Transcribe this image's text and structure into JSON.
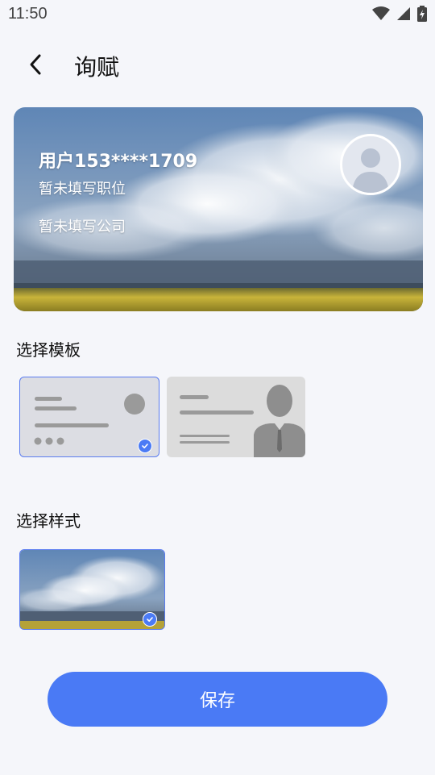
{
  "status_bar": {
    "time": "11:50"
  },
  "header": {
    "title": "询赋"
  },
  "card": {
    "name": "用户153****1709",
    "position": "暂未填写职位",
    "company": "暂未填写公司"
  },
  "sections": {
    "template_title": "选择模板",
    "style_title": "选择样式"
  },
  "templates": [
    {
      "id": "template-1",
      "selected": true
    },
    {
      "id": "template-2",
      "selected": false
    }
  ],
  "styles": [
    {
      "id": "style-sky-field",
      "selected": true
    }
  ],
  "actions": {
    "save_label": "保存"
  },
  "colors": {
    "accent": "#4a7af5",
    "background": "#f5f6fa"
  }
}
